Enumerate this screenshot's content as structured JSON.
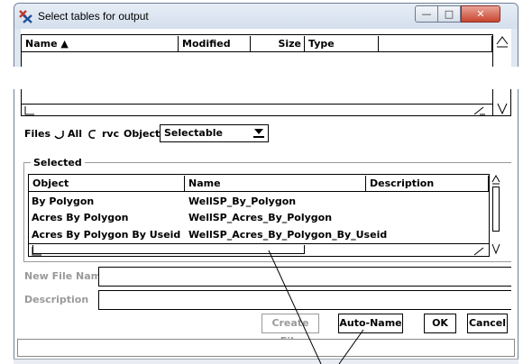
{
  "window": {
    "title": "Select tables for output",
    "controls": {
      "minimize": "—",
      "maximize": "□",
      "close": "✕"
    }
  },
  "file_list": {
    "columns": [
      "Name ▲",
      "Modified",
      "Size",
      "Type"
    ]
  },
  "filter": {
    "files_label": "Files",
    "all_label": "All",
    "rvc_label": "rvc",
    "objects_label": "Objects",
    "objects_value": "Selectable"
  },
  "selected": {
    "legend": "Selected",
    "columns": [
      "Object",
      "Name",
      "Description"
    ],
    "rows": [
      {
        "object": "By Polygon",
        "name": "WellSP_By_Polygon",
        "description": ""
      },
      {
        "object": "Acres By Polygon",
        "name": "WellSP_Acres_By_Polygon",
        "description": ""
      },
      {
        "object": "Acres By Polygon By Useid",
        "name": "WellSP_Acres_By_Polygon_By_Useid",
        "description": ""
      }
    ]
  },
  "form": {
    "new_file_name_label": "New File Name",
    "new_file_name_value": "",
    "description_label": "Description",
    "description_value": ""
  },
  "buttons": {
    "create_file": "Create File",
    "auto_name": "Auto-Name",
    "ok": "OK",
    "cancel": "Cancel"
  },
  "status": {
    "text": ""
  },
  "colors": {
    "title_bg": "#dfe7f1",
    "close_button": "#c9452f",
    "disabled_text": "#9a9a9a"
  }
}
